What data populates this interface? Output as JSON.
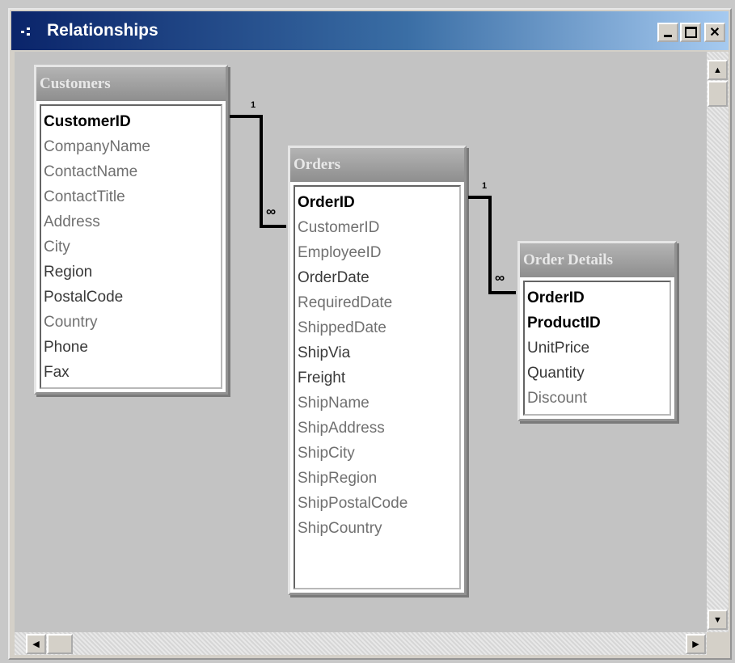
{
  "window": {
    "title": "Relationships"
  },
  "tables": {
    "customers": {
      "name": "Customers",
      "fields": [
        "CustomerID",
        "CompanyName",
        "ContactName",
        "ContactTitle",
        "Address",
        "City",
        "Region",
        "PostalCode",
        "Country",
        "Phone",
        "Fax"
      ]
    },
    "orders": {
      "name": "Orders",
      "fields": [
        "OrderID",
        "CustomerID",
        "EmployeeID",
        "OrderDate",
        "RequiredDate",
        "ShippedDate",
        "ShipVia",
        "Freight",
        "ShipName",
        "ShipAddress",
        "ShipCity",
        "ShipRegion",
        "ShipPostalCode",
        "ShipCountry"
      ]
    },
    "order_details": {
      "name": "Order Details",
      "fields": [
        "OrderID",
        "ProductID",
        "UnitPrice",
        "Quantity",
        "Discount"
      ]
    }
  },
  "relationships": [
    {
      "one_label": "1",
      "many_label": "∞"
    },
    {
      "one_label": "1",
      "many_label": "∞"
    }
  ],
  "icons": {
    "system_menu": "system-menu-icon",
    "minimize": "minimize-icon",
    "maximize": "maximize-icon",
    "close": "close-icon"
  }
}
